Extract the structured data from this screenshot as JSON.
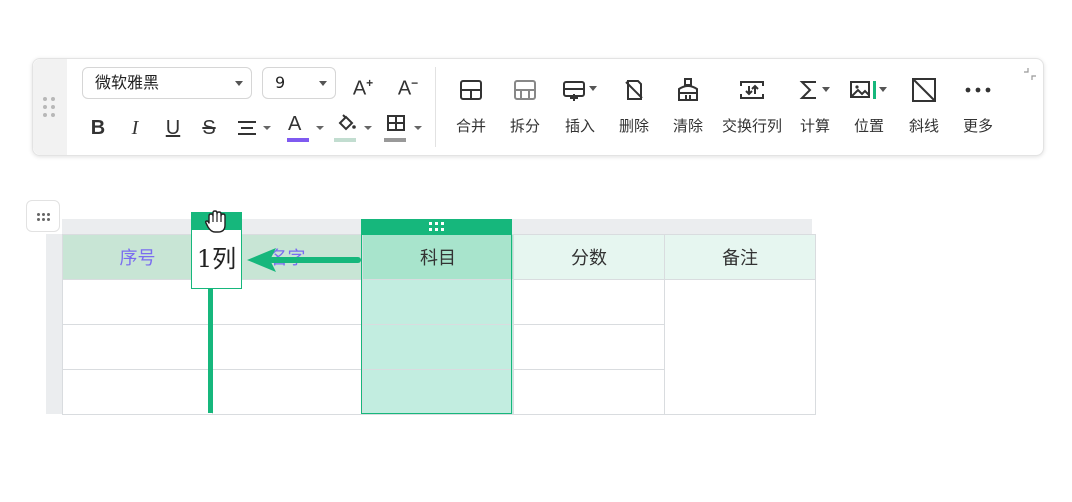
{
  "toolbar": {
    "font_family": "微软雅黑",
    "font_size": "9",
    "increase_font": "A",
    "decrease_font": "A",
    "format": {
      "bold": "B",
      "italic": "I",
      "underline": "U",
      "strike": "S",
      "font_color": "A",
      "font_color_value": "#7f5af0",
      "fill_color_value": "#c2ddd0"
    },
    "tools": [
      {
        "label": "合并",
        "icon": "merge-cells-icon"
      },
      {
        "label": "拆分",
        "icon": "split-cells-icon"
      },
      {
        "label": "插入",
        "icon": "insert-icon"
      },
      {
        "label": "删除",
        "icon": "delete-icon"
      },
      {
        "label": "清除",
        "icon": "clear-icon"
      },
      {
        "label": "交换行列",
        "icon": "swap-rows-cols-icon"
      },
      {
        "label": "计算",
        "icon": "sum-icon"
      },
      {
        "label": "位置",
        "icon": "image-position-icon"
      },
      {
        "label": "斜线",
        "icon": "diagonal-line-icon"
      },
      {
        "label": "更多",
        "icon": "more-icon"
      }
    ]
  },
  "table": {
    "headers": [
      "序号",
      "名字",
      "科目",
      "分数",
      "备注"
    ],
    "rows": [
      [
        "",
        "",
        "",
        "",
        ""
      ],
      [
        "",
        "",
        "",
        "",
        ""
      ],
      [
        "",
        "",
        "",
        "",
        ""
      ]
    ]
  },
  "drag_ghost": {
    "label": "1列"
  },
  "colors": {
    "accent": "#16b77c",
    "header_bg": "#e6f6f0",
    "selected_col": "#c2ede0",
    "moved_header_text": "#7a6cf0"
  }
}
